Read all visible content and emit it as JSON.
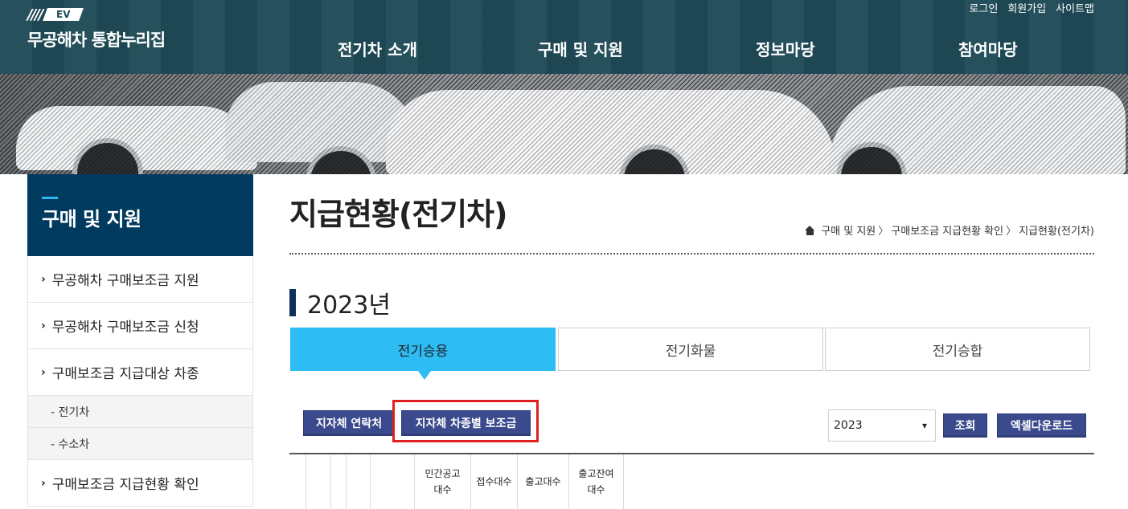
{
  "header": {
    "logo_slashes": "////",
    "logo_badge": "EV",
    "logo_text": "무공해차 통합누리집",
    "utility": [
      "로그인",
      "회원가입",
      "사이트맵"
    ],
    "nav": [
      "전기차 소개",
      "구매 및 지원",
      "정보마당",
      "참여마당"
    ]
  },
  "sidebar": {
    "title": "구매 및 지원",
    "items": [
      {
        "label": "무공해차 구매보조금 지원"
      },
      {
        "label": "무공해차 구매보조금 신청"
      },
      {
        "label": "구매보조금 지급대상 차종"
      }
    ],
    "subitems": [
      "- 전기차",
      "- 수소차"
    ],
    "last_item": "구매보조금 지급현황 확인"
  },
  "page": {
    "title": "지급현황(전기차)",
    "breadcrumb": [
      "구매 및 지원",
      "구매보조금 지급현황 확인",
      "지급현황(전기차)"
    ],
    "year_heading": "2023년"
  },
  "tabs": [
    "전기승용",
    "전기화물",
    "전기승합"
  ],
  "toolbar": {
    "contact_btn": "지자체 연락처",
    "subsidy_btn": "지자체 차종별 보조금",
    "year_select": "2023",
    "search_btn": "조회",
    "excel_btn": "엑셀다운로드"
  },
  "table": {
    "headers": [
      "",
      "",
      "",
      "",
      "",
      "민간공고\n대수",
      "접수대수",
      "출고대수",
      "출고잔여\n대수"
    ]
  },
  "colors": {
    "header_bg": "#1f4b57",
    "sidebar_head": "#003a5f",
    "tab_active": "#2ebcf5",
    "button": "#3a4a8c",
    "highlight": "#e02020"
  }
}
